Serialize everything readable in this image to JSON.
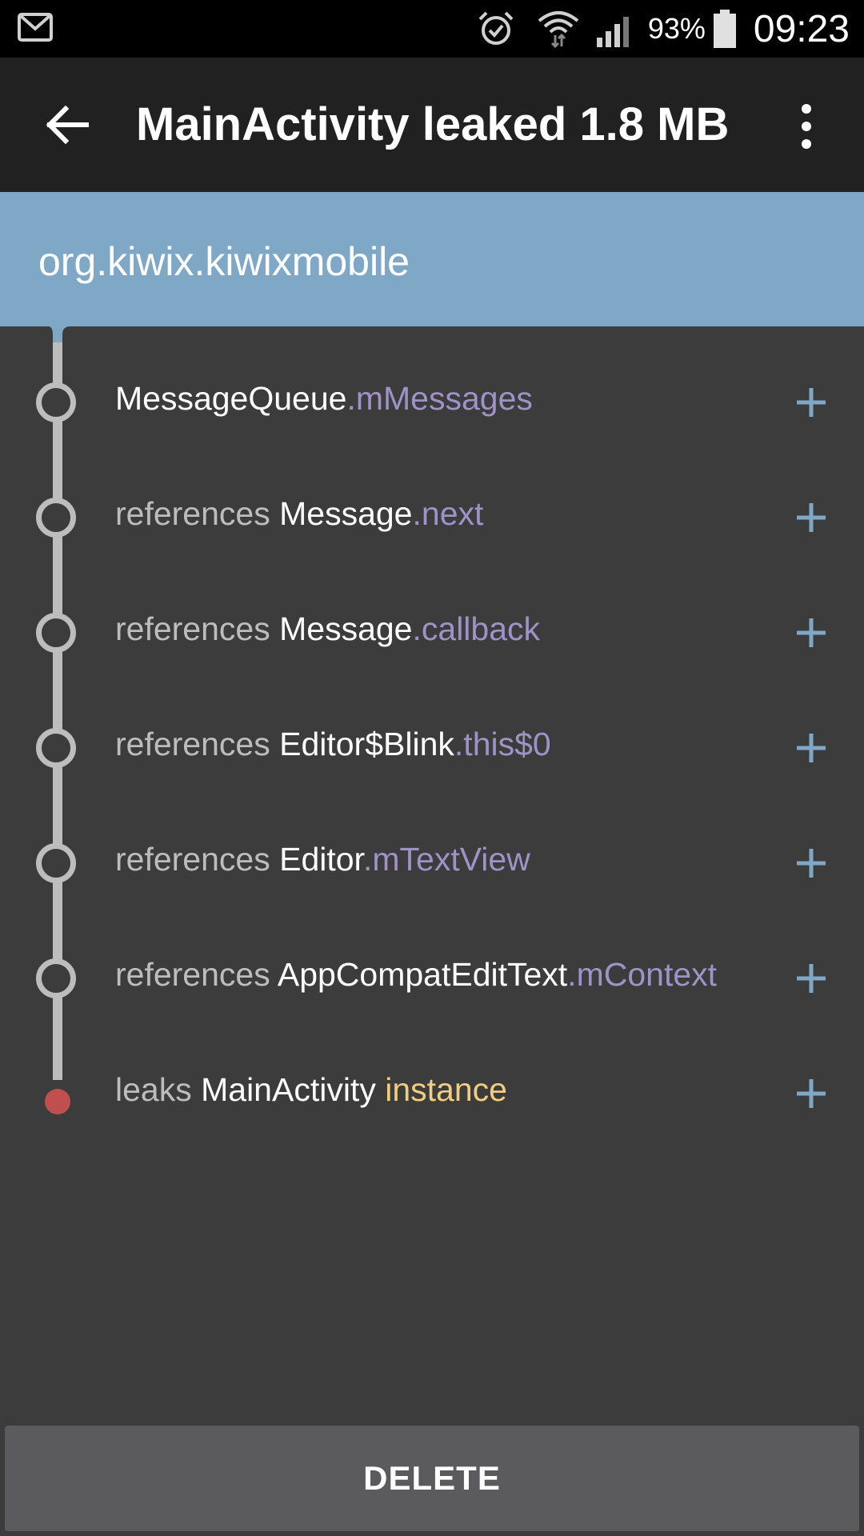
{
  "status_bar": {
    "battery_percent": "93%",
    "time": "09:23",
    "icons": [
      "gmail-icon",
      "alarm-icon",
      "wifi-icon",
      "signal-icon",
      "battery-icon"
    ]
  },
  "app_bar": {
    "title": "MainActivity leaked 1.8 MB"
  },
  "package": {
    "name": "org.kiwix.kiwixmobile"
  },
  "trace": [
    {
      "prefix": "",
      "class": "MessageQueue",
      "sep": ".",
      "field": "mMessages",
      "kind": "field"
    },
    {
      "prefix": "references ",
      "class": "Message",
      "sep": ".",
      "field": "next",
      "kind": "field"
    },
    {
      "prefix": "references ",
      "class": "Message",
      "sep": ".",
      "field": "callback",
      "kind": "field"
    },
    {
      "prefix": "references ",
      "class": "Editor$Blink",
      "sep": ".",
      "field": "this$0",
      "kind": "field"
    },
    {
      "prefix": "references ",
      "class": "Editor",
      "sep": ".",
      "field": "mTextView",
      "kind": "field"
    },
    {
      "prefix": "references ",
      "class": "AppCompatEditText",
      "sep": ".",
      "field": "mContext",
      "kind": "field"
    },
    {
      "prefix": "leaks ",
      "class": "MainActivity",
      "sep": " ",
      "field": "instance",
      "kind": "leak"
    }
  ],
  "actions": {
    "delete_label": "DELETE"
  },
  "colors": {
    "status_bar": "#000000",
    "app_bar": "#212121",
    "package_header": "#7fa7c6",
    "background": "#3c3c3c",
    "rail": "#bdbdbd",
    "field_text": "#9f92c7",
    "leak_instance_text": "#f0cd7f",
    "leak_dot": "#c0504d",
    "expand_icon": "#7fa7c6",
    "delete_button": "#5b5b5d"
  }
}
